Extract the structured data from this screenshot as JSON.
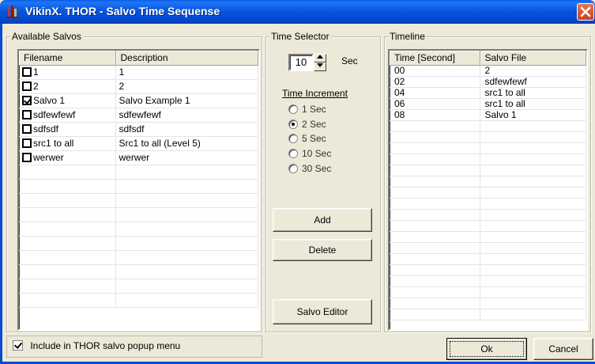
{
  "window": {
    "title": "VikinX. THOR - Salvo Time Sequense",
    "icons": {
      "app": "app-icon",
      "close": "close-icon"
    }
  },
  "available_salvos": {
    "group_label": "Available Salvos",
    "columns": [
      "Filename",
      "Description"
    ],
    "rows": [
      {
        "filename": "1",
        "description": "1",
        "checked": false
      },
      {
        "filename": "2",
        "description": "2",
        "checked": false
      },
      {
        "filename": "Salvo 1",
        "description": "Salvo Example 1",
        "checked": true
      },
      {
        "filename": "sdfewfewf",
        "description": "sdfewfewf",
        "checked": false
      },
      {
        "filename": "sdfsdf",
        "description": "sdfsdf",
        "checked": false
      },
      {
        "filename": "src1 to all",
        "description": "Src1 to all (Level 5)",
        "checked": false
      },
      {
        "filename": "werwer",
        "description": "werwer",
        "checked": false
      }
    ]
  },
  "time_selector": {
    "group_label": "Time Selector",
    "value": "10",
    "unit": "Sec",
    "increment_label": "Time Increment",
    "options": [
      "1 Sec",
      "2 Sec",
      "5 Sec",
      "10 Sec",
      "30 Sec"
    ],
    "selected": "2 Sec",
    "add_label": "Add",
    "delete_label": "Delete",
    "editor_label": "Salvo Editor"
  },
  "timeline": {
    "group_label": "Timeline",
    "columns": [
      "Time [Second]",
      "Salvo File"
    ],
    "rows": [
      {
        "time": "00",
        "file": "2"
      },
      {
        "time": "02",
        "file": "sdfewfewf"
      },
      {
        "time": "04",
        "file": "src1 to all"
      },
      {
        "time": "06",
        "file": "src1 to all"
      },
      {
        "time": "08",
        "file": "Salvo 1"
      }
    ]
  },
  "footer": {
    "include_label": "Include in THOR salvo popup menu",
    "include_checked": true,
    "ok_label": "Ok",
    "cancel_label": "Cancel"
  }
}
